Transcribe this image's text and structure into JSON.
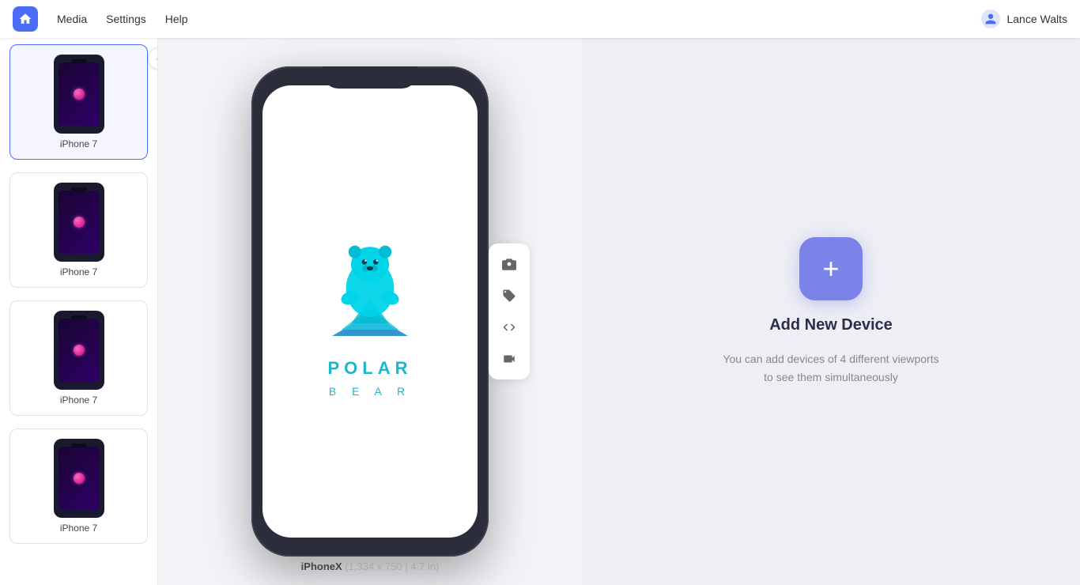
{
  "nav": {
    "logo_label": "Home",
    "links": [
      "Media",
      "Settings",
      "Help"
    ],
    "user": "Lance Walts"
  },
  "sidebar": {
    "collapse_label": "«",
    "devices": [
      {
        "label": "iPhone 7",
        "selected": true
      },
      {
        "label": "iPhone 7",
        "selected": false
      },
      {
        "label": "iPhone 7",
        "selected": false
      },
      {
        "label": "iPhone 7",
        "selected": false
      }
    ]
  },
  "viewport": {
    "device_name": "iPhoneX",
    "device_specs": "(1,334 x 750  |  4.7 in)",
    "app_logo_text": "POLAR",
    "app_logo_sub": "B E A R",
    "toolbar_icons": [
      "camera",
      "tag",
      "code",
      "video"
    ]
  },
  "add_device": {
    "button_label": "+",
    "title": "Add New Device",
    "description": "You can add devices of 4 different viewports to see them simultaneously"
  }
}
